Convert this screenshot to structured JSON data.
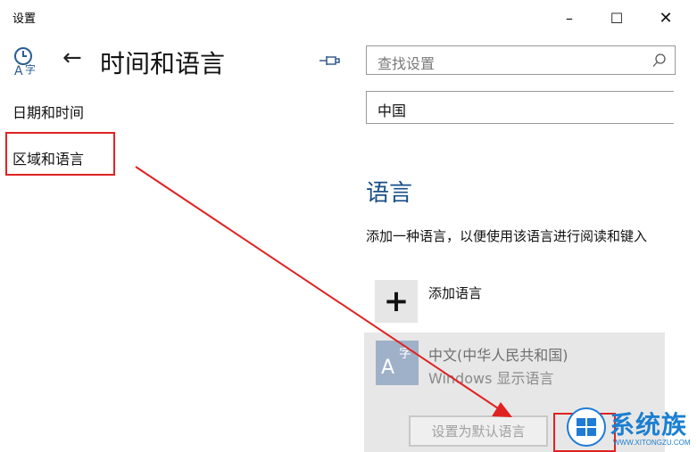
{
  "window": {
    "title": "设置",
    "min": "–",
    "max": "☐",
    "close": "✕"
  },
  "header": {
    "back": "←",
    "title": "时间和语言",
    "icon": "time-language-icon",
    "pin_icon": "pin-icon"
  },
  "search": {
    "placeholder": "查找设置",
    "icon": "search-icon"
  },
  "nav": {
    "items": [
      {
        "label": "日期和时间"
      },
      {
        "label": "区域和语言"
      }
    ]
  },
  "region": {
    "country": "中国"
  },
  "language": {
    "heading": "语言",
    "description": "添加一种语言，以便使用该语言进行阅读和键入",
    "add_icon": "+",
    "add_label": "添加语言",
    "item": {
      "icon_a": "A",
      "icon_z": "字",
      "name": "中文(中华人民共和国)",
      "sub": "Windows 显示语言",
      "default_btn": "设置为默认语言"
    }
  },
  "watermark": {
    "text": "系统族",
    "sub": "WWW.XITONGZU.COM"
  },
  "colors": {
    "accent": "#1a4f8a",
    "annotation": "#e02222"
  }
}
